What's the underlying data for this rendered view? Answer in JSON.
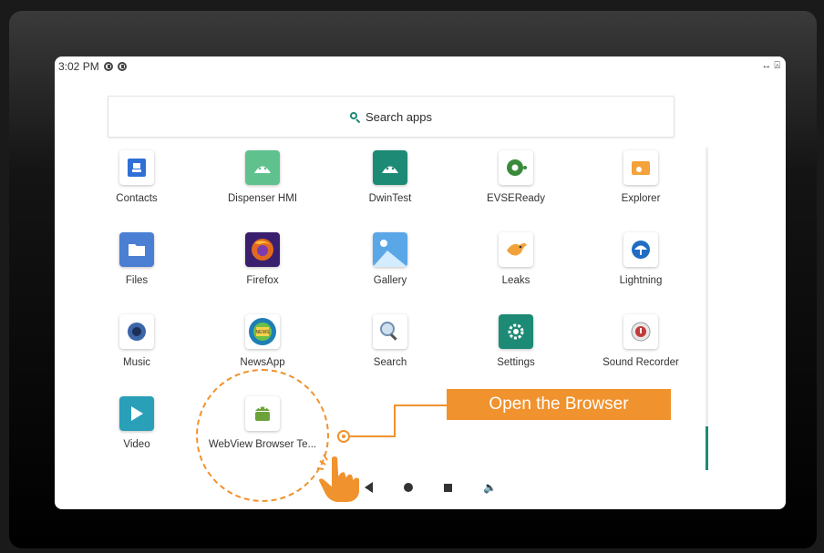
{
  "status": {
    "time": "3:02 PM",
    "right_icons": "↔ ⍓"
  },
  "search": {
    "label": "Search apps"
  },
  "apps": [
    {
      "name": "Contacts",
      "icon": "contacts-icon",
      "color": "#2f6fd6"
    },
    {
      "name": "Dispenser HMI",
      "icon": "android-icon",
      "color": "#5fc28e"
    },
    {
      "name": "DwinTest",
      "icon": "android-icon",
      "color": "#1d8a75"
    },
    {
      "name": "EVSEReady",
      "icon": "gear-plug-icon",
      "color": "#3b8a3b"
    },
    {
      "name": "Explorer",
      "icon": "explorer-icon",
      "color": "#f4a23a"
    },
    {
      "name": "Files",
      "icon": "folder-icon",
      "color": "#4a7fd4"
    },
    {
      "name": "Firefox",
      "icon": "firefox-icon",
      "color": "#e26a1f"
    },
    {
      "name": "Gallery",
      "icon": "gallery-icon",
      "color": "#5aa7e8"
    },
    {
      "name": "Leaks",
      "icon": "bird-icon",
      "color": "#f1a23a"
    },
    {
      "name": "Lightning",
      "icon": "lightning-icon",
      "color": "#1f6cc2"
    },
    {
      "name": "Music",
      "icon": "music-icon",
      "color": "#3d66a8"
    },
    {
      "name": "NewsApp",
      "icon": "news-icon",
      "color": "#1f7fb5"
    },
    {
      "name": "Search",
      "icon": "search-magnifier-icon",
      "color": "#6d8fb0"
    },
    {
      "name": "Settings",
      "icon": "settings-icon",
      "color": "#1d8a75"
    },
    {
      "name": "Sound Recorder",
      "icon": "recorder-icon",
      "color": "#c23b3b"
    },
    {
      "name": "Video",
      "icon": "play-icon",
      "color": "#2aa0b8"
    },
    {
      "name": "WebView Browser Te...",
      "icon": "android-icon",
      "color": "#6ba33a"
    }
  ],
  "callout": {
    "text": "Open the Browser",
    "color": "#f0922d"
  },
  "accent": "#1d8a75"
}
